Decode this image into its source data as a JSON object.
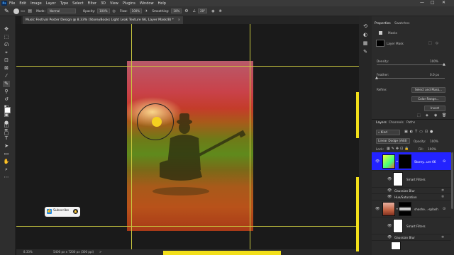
{
  "menu": {
    "app_logo": "Ps",
    "items": [
      "File",
      "Edit",
      "Image",
      "Layer",
      "Type",
      "Select",
      "Filter",
      "3D",
      "View",
      "Plugins",
      "Window",
      "Help"
    ]
  },
  "window_controls": {
    "minimize": "—",
    "restore": "□",
    "close": "✕"
  },
  "options_bar": {
    "brush_size": "300",
    "mode_label": "Mode:",
    "mode_value": "Normal",
    "opacity_label": "Opacity:",
    "opacity_value": "100%",
    "flow_label": "Flow:",
    "flow_value": "100%",
    "smoothing_label": "Smoothing:",
    "smoothing_value": "10%",
    "angle_value": "20°"
  },
  "document": {
    "tab_title": "Music Festival Poster Design @ 8.33% (StoreyBooks Light Leak Texture 66, Layer Mask/8) *",
    "tab_close": "×"
  },
  "canvas": {
    "subscribe_label": "Subscribe",
    "bell_icon": "bell-icon"
  },
  "status_bar": {
    "zoom": "8.33%",
    "doc_size": "5400 px x 7200 px (300 ppi)",
    "arrow": ">"
  },
  "properties": {
    "tab_properties": "Properties",
    "tab_swatches": "Swatches",
    "masks_label": "Masks",
    "layer_mask_label": "Layer Mask",
    "density_label": "Density:",
    "density_value": "100%",
    "feather_label": "Feather:",
    "feather_value": "0.0 px",
    "refine_label": "Refine:",
    "select_and_mask": "Select and Mask...",
    "color_range": "Color Range...",
    "invert": "Invert"
  },
  "layers": {
    "tab_layers": "Layers",
    "tab_channels": "Channels",
    "tab_paths": "Paths",
    "filter_kind": "Kind",
    "blend_mode": "Linear Dodge (Add)",
    "opacity_label": "Opacity:",
    "opacity_value": "100%",
    "lock_label": "Lock:",
    "fill_label": "Fill:",
    "fill_value": "100%",
    "rows": [
      {
        "name": "Storey...ure 66",
        "type": "layer-with-mask",
        "selected": true
      },
      {
        "name": "Smart Filters",
        "type": "smart-filters",
        "selected": false
      },
      {
        "name": "Gaussian Blur",
        "type": "filter",
        "selected": false
      },
      {
        "name": "Hue/Saturation",
        "type": "filter",
        "selected": false
      },
      {
        "name": "shashe...-splash",
        "type": "layer-with-mask",
        "selected": false
      },
      {
        "name": "Smart Filters",
        "type": "smart-filters",
        "selected": false
      },
      {
        "name": "Gaussian Blur",
        "type": "filter",
        "selected": false
      }
    ]
  },
  "colors": {
    "accent_selected": "#2323ff",
    "guide": "#c9c840",
    "marker": "#f2df1a"
  }
}
